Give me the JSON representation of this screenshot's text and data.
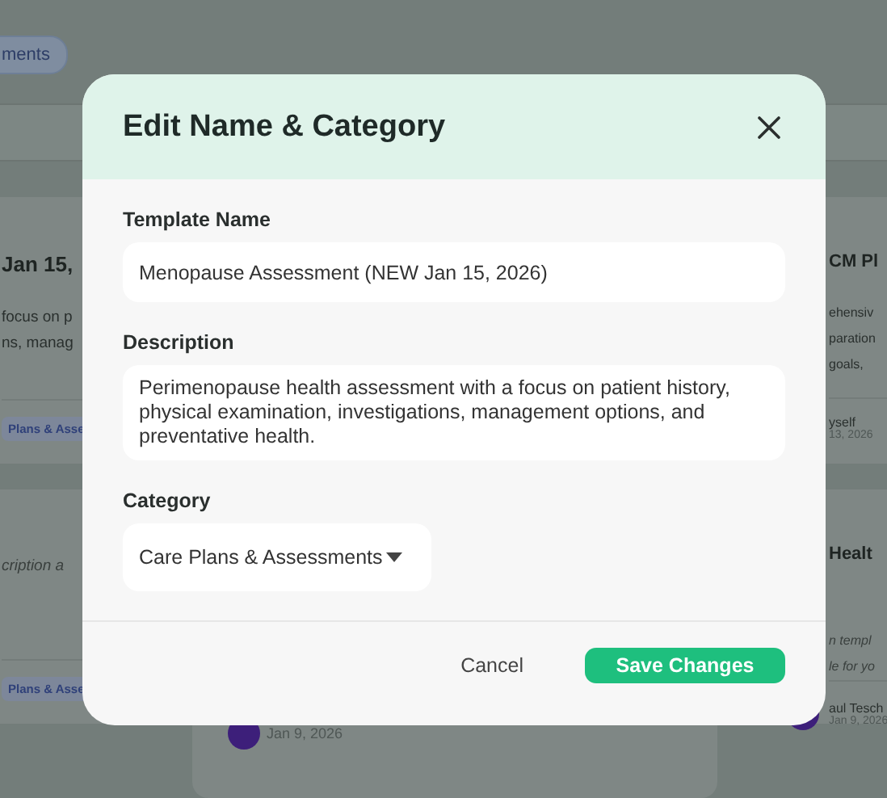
{
  "background": {
    "tabs": [
      {
        "label": "ments",
        "selected": true
      }
    ],
    "left_cards": [
      {
        "title": "Jan 15,",
        "description": [
          "focus on p",
          "ns, manag"
        ],
        "italic": false,
        "tag": "Plans & Asse"
      },
      {
        "description": [
          "cription a"
        ],
        "italic": true,
        "tag": "Plans & Asse"
      }
    ],
    "middle_cards": [
      {
        "avatar": true,
        "date": "Jan 9, 2026"
      }
    ],
    "right_cards": [
      {
        "title": "CM Pl",
        "description": [
          "ehensiv",
          "paration",
          "goals,"
        ],
        "italic": false,
        "author": "yself",
        "date": "13, 2026"
      },
      {
        "title": "Healt",
        "description": [
          "n templ",
          "le for yo"
        ],
        "italic": true,
        "avatar": true,
        "author": "aul Tesch",
        "date": "Jan 9, 2026"
      }
    ]
  },
  "dialog": {
    "title": "Edit Name & Category",
    "fields": [
      {
        "kind": "text",
        "label": "Template Name",
        "value": "Menopause Assessment (NEW Jan 15, 2026)"
      },
      {
        "kind": "textarea",
        "label": "Description",
        "value": "Perimenopause health assessment with a focus on patient history, physical examination, investigations, management options, and preventative health."
      },
      {
        "kind": "select",
        "label": "Category",
        "value": "Care Plans & Assessments"
      }
    ],
    "buttons": [
      {
        "kind": "secondary",
        "label": "Cancel"
      },
      {
        "kind": "primary",
        "label": "Save Changes"
      }
    ]
  }
}
